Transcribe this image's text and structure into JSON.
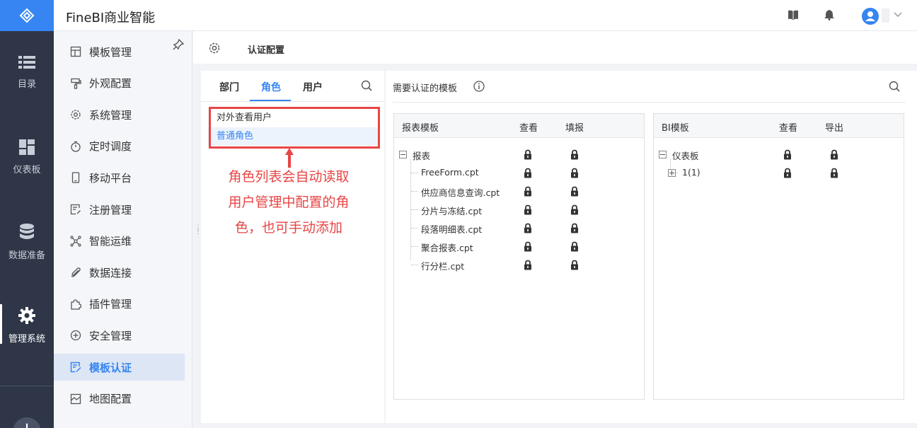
{
  "app": {
    "title": "FineBI商业智能"
  },
  "rail": {
    "items": [
      {
        "label": "目录",
        "icon": "list-icon"
      },
      {
        "label": "仪表板",
        "icon": "dashboard-icon"
      },
      {
        "label": "数据准备",
        "icon": "database-icon"
      },
      {
        "label": "管理系统",
        "icon": "gear-icon",
        "active": true
      }
    ],
    "add_label": "+"
  },
  "header": {
    "icons": [
      "book-icon",
      "bell-icon",
      "user-avatar-icon",
      "chevron-down-icon"
    ]
  },
  "subnav": {
    "items": [
      {
        "label": "模板管理",
        "icon": "template-icon"
      },
      {
        "label": "外观配置",
        "icon": "brush-icon"
      },
      {
        "label": "系统管理",
        "icon": "settings-icon"
      },
      {
        "label": "定时调度",
        "icon": "timer-icon"
      },
      {
        "label": "移动平台",
        "icon": "mobile-icon"
      },
      {
        "label": "注册管理",
        "icon": "register-icon"
      },
      {
        "label": "智能运维",
        "icon": "network-icon"
      },
      {
        "label": "数据连接",
        "icon": "paperclip-icon"
      },
      {
        "label": "插件管理",
        "icon": "puzzle-icon"
      },
      {
        "label": "安全管理",
        "icon": "shield-icon"
      },
      {
        "label": "模板认证",
        "icon": "certify-icon",
        "active": true
      },
      {
        "label": "地图配置",
        "icon": "map-icon"
      }
    ]
  },
  "content": {
    "title": "认证配置"
  },
  "left_panel": {
    "tabs": [
      {
        "label": "部门"
      },
      {
        "label": "角色",
        "active": true
      },
      {
        "label": "用户"
      }
    ],
    "roles": [
      {
        "label": "对外查看用户"
      },
      {
        "label": "普通角色",
        "selected": true
      }
    ]
  },
  "annotation": {
    "lines": [
      "角色列表会自动读取",
      "用户管理中配置的角",
      "色，也可手动添加"
    ],
    "color": "#e84545"
  },
  "right_panel": {
    "title": "需要认证的模板",
    "report_box": {
      "columns": [
        "报表模板",
        "查看",
        "填报"
      ],
      "root": "报表",
      "items": [
        "FreeForm.cpt",
        "供应商信息查询.cpt",
        "分片与冻结.cpt",
        "段落明细表.cpt",
        "聚合报表.cpt",
        "行分栏.cpt"
      ]
    },
    "bi_box": {
      "columns": [
        "BI模板",
        "查看",
        "导出"
      ],
      "root": "仪表板",
      "items": [
        "1(1)"
      ]
    }
  },
  "colors": {
    "accent": "#3685f2",
    "rail_bg": "#2e3647",
    "highlight": "#e84545"
  }
}
